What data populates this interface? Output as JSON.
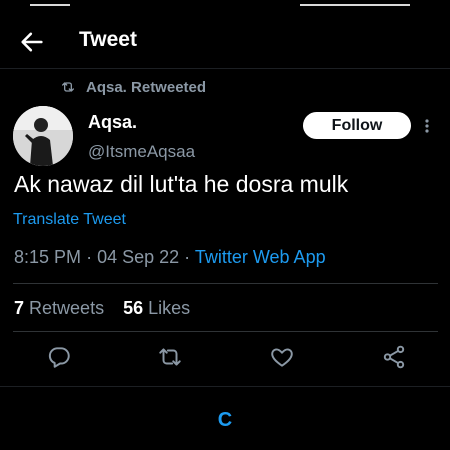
{
  "header": {
    "title": "Tweet",
    "back_icon": "back-arrow-icon"
  },
  "retweet_notice": {
    "text": "Aqsa. Retweeted",
    "icon": "retweet-icon"
  },
  "author": {
    "name": "Aqsa.",
    "handle": "@ItsmeAqsaa",
    "follow_label": "Follow"
  },
  "tweet": {
    "text": "Ak nawaz dil lut'ta he dosra mulk",
    "translate_label": "Translate Tweet",
    "time": "8:15 PM",
    "date": "04 Sep 22",
    "source": "Twitter Web App",
    "sep": "·"
  },
  "stats": {
    "retweets_count": "7",
    "retweets_label": "Retweets",
    "likes_count": "56",
    "likes_label": "Likes"
  },
  "actions": [
    {
      "name": "reply",
      "icon": "reply-icon"
    },
    {
      "name": "retweet",
      "icon": "retweet-icon"
    },
    {
      "name": "like",
      "icon": "heart-icon"
    },
    {
      "name": "share",
      "icon": "share-icon"
    }
  ],
  "footer": {
    "loading_char": "C"
  },
  "colors": {
    "accent": "#1d9bf0",
    "background": "#000000",
    "muted": "#8b98a5"
  }
}
